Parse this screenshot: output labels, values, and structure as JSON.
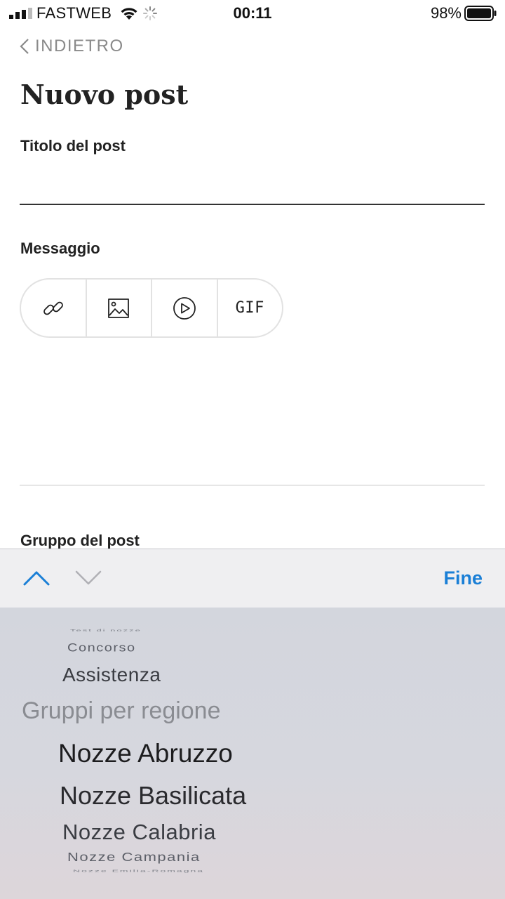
{
  "status_bar": {
    "carrier": "FASTWEB",
    "time": "00:11",
    "battery": "98%",
    "icons": [
      "signal-icon",
      "wifi-icon",
      "activity-spinner-icon",
      "battery-icon"
    ]
  },
  "nav": {
    "back_label": "INDIETRO",
    "back_icon": "chevron-left-icon"
  },
  "page": {
    "title": "Nuovo post"
  },
  "form": {
    "title_label": "Titolo del post",
    "title_value": "",
    "message_label": "Messaggio",
    "toolbar": {
      "tools": [
        "link-icon",
        "image-icon",
        "play-icon",
        "gif-icon"
      ],
      "gif_label": "GIF"
    },
    "group_label": "Gruppo del post"
  },
  "accessory": {
    "prev_icon": "chevron-up-icon",
    "next_icon": "chevron-down-icon",
    "done_label": "Fine",
    "accent": "#1a7fd6"
  },
  "picker": {
    "items": [
      "Test di nozze",
      "Concorso",
      "Assistenza",
      "Gruppi per regione",
      "Nozze Abruzzo",
      "Nozze Basilicata",
      "Nozze Calabria",
      "Nozze Campania",
      "Nozze Emilia-Romagna"
    ],
    "selected": "Nozze Abruzzo"
  }
}
